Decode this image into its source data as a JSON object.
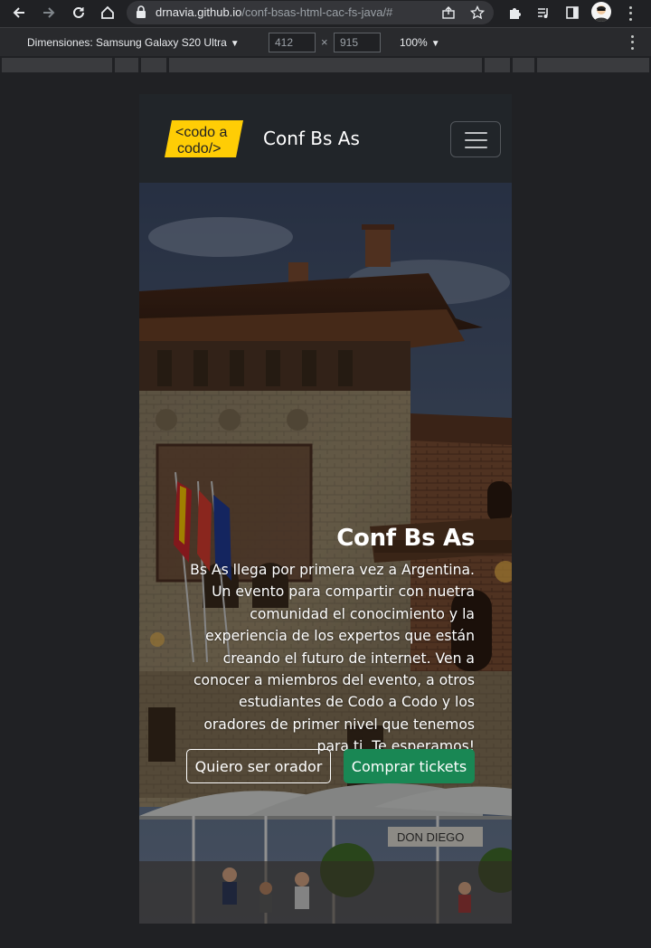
{
  "browser": {
    "url_host": "drnavia.github.io",
    "url_path": "/conf-bsas-html-cac-fs-java/#"
  },
  "devtools": {
    "device_label": "Dimensiones: Samsung Galaxy S20 Ultra",
    "width_value": "412",
    "height_value": "915",
    "times_symbol": "×",
    "zoom_label": "100%"
  },
  "site": {
    "logo_line1": "<codo a",
    "logo_line2": "codo/>",
    "brand": "Conf Bs As",
    "hero": {
      "title": "Conf Bs As",
      "text": "Bs As llega por primera vez a Argentina. Un evento para compartir con nuetra comunidad el conocimiento y la experiencia de los expertos que están creando el futuro de internet. Ven a conocer a miembros del evento, a otros estudiantes de Codo a Codo y los oradores de primer nivel que tenemos para ti. Te esperamos!",
      "btn_speaker": "Quiero ser orador",
      "btn_tickets": "Comprar tickets",
      "sign": "DON DIEGO"
    }
  },
  "colors": {
    "logo_yellow": "#ffcd05",
    "success": "#198754",
    "navbar": "#212529"
  }
}
